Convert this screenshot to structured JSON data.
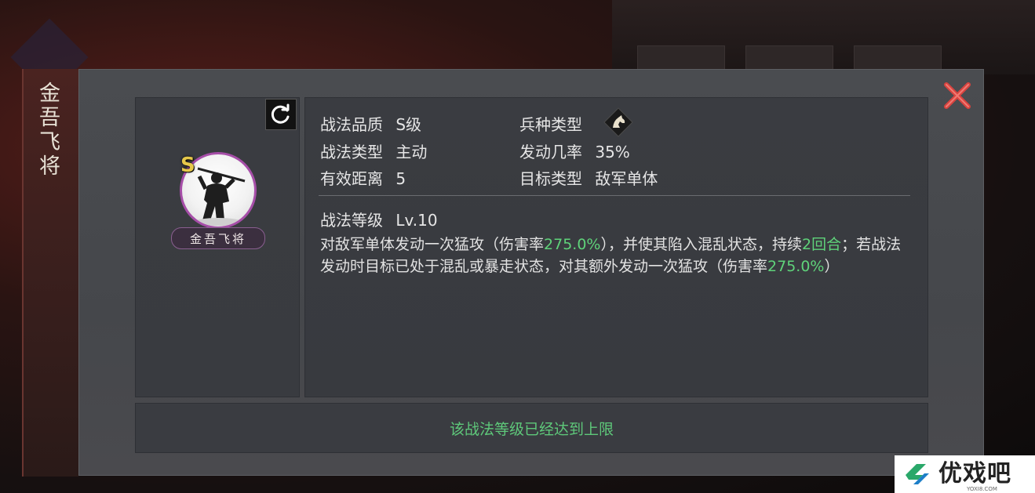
{
  "skill": {
    "name_vertical": "金吾飞将",
    "name_plate": "金吾飞将",
    "grade_badge": "S",
    "info": {
      "quality_label": "战法品质",
      "quality_value": "S级",
      "troop_label": "兵种类型",
      "troop_icon": "cavalry-horse-icon",
      "type_label": "战法类型",
      "type_value": "主动",
      "rate_label": "发动几率",
      "rate_value": "35%",
      "range_label": "有效距离",
      "range_value": "5",
      "target_label": "目标类型",
      "target_value": "敌军单体"
    },
    "level_label": "战法等级",
    "level_value": "Lv.10",
    "description": {
      "p1": "对敌军单体发动一次猛攻（伤害率",
      "v1": "275.0%",
      "p2": "），并使其陷入混乱状态，持续",
      "v2": "2回合",
      "p3": "；若战法发动时目标已处于混乱或暴走状态，对其额外发动一次猛攻（伤害率",
      "v3": "275.0%",
      "p4": "）"
    },
    "status_text": "该战法等级已经达到上限"
  },
  "watermark": {
    "text": "优戏吧",
    "sub": "YOXI8.COM"
  },
  "colors": {
    "highlight": "#5fd37a",
    "close": "#d9433f",
    "portrait_border": "#a64ea8",
    "grade_s": "#e6c84a"
  }
}
